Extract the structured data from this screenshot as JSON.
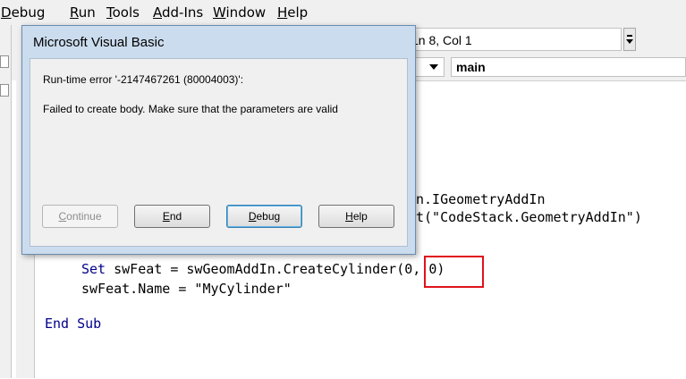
{
  "menu": [
    {
      "pre": "",
      "ul": "D",
      "post": "ebug"
    },
    {
      "pre": "",
      "ul": "R",
      "post": "un"
    },
    {
      "pre": "",
      "ul": "T",
      "post": "ools"
    },
    {
      "pre": "",
      "ul": "A",
      "post": "dd-Ins"
    },
    {
      "pre": "",
      "ul": "W",
      "post": "indow"
    },
    {
      "pre": "",
      "ul": "H",
      "post": "elp"
    }
  ],
  "toolbar": {
    "position": "Ln 8, Col 1"
  },
  "code_combos": {
    "procedure": "main"
  },
  "code": {
    "l1_tail": "n.IGeometryAddIn",
    "l2_tail": "t(\"CodeStack.GeometryAddIn\")",
    "l3_kw": "Set",
    "l3_rest": " swFeat = swGeomAddIn.CreateCylinder(0, 0)",
    "l4": "swFeat.Name = \"MyCylinder\"",
    "l5_kw": "End Sub"
  },
  "dialog": {
    "title": "Microsoft Visual Basic",
    "error_line": "Run-time error '-2147467261 (80004003)':",
    "message": "Failed to create body. Make sure that the parameters are valid",
    "buttons": {
      "continue": {
        "ul": "C",
        "post": "ontinue"
      },
      "end": {
        "ul": "E",
        "post": "nd"
      },
      "debug": {
        "ul": "D",
        "post": "ebug"
      },
      "help": {
        "ul": "H",
        "post": "elp"
      }
    }
  },
  "colors": {
    "keyword": "#00008b",
    "highlight": "#e0121c",
    "dialog_frame": "#cbdcee"
  }
}
